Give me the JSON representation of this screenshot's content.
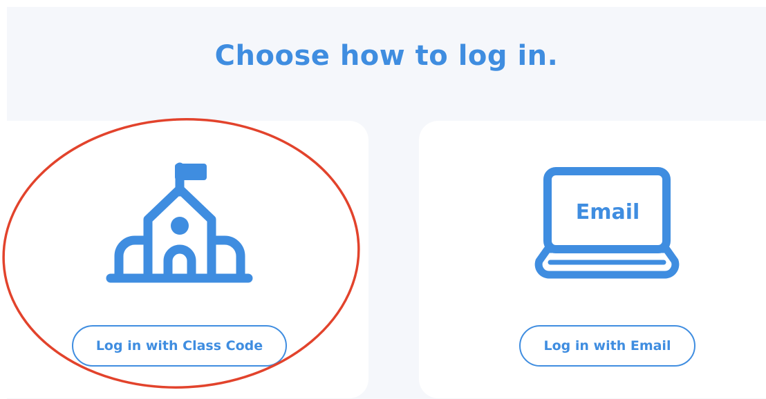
{
  "header": {
    "title": "Choose how to log in."
  },
  "options": {
    "class_code": {
      "icon": "school-icon",
      "button_label": "Log in with Class Code"
    },
    "email": {
      "icon": "laptop-email-icon",
      "icon_text": "Email",
      "button_label": "Log in with Email"
    }
  },
  "annotation": {
    "type": "red-circle-highlight",
    "target": "class_code",
    "color": "#e2432c"
  },
  "colors": {
    "accent": "#3f8de0",
    "background": "#f5f7fb",
    "card": "#ffffff",
    "annotation": "#e2432c"
  }
}
